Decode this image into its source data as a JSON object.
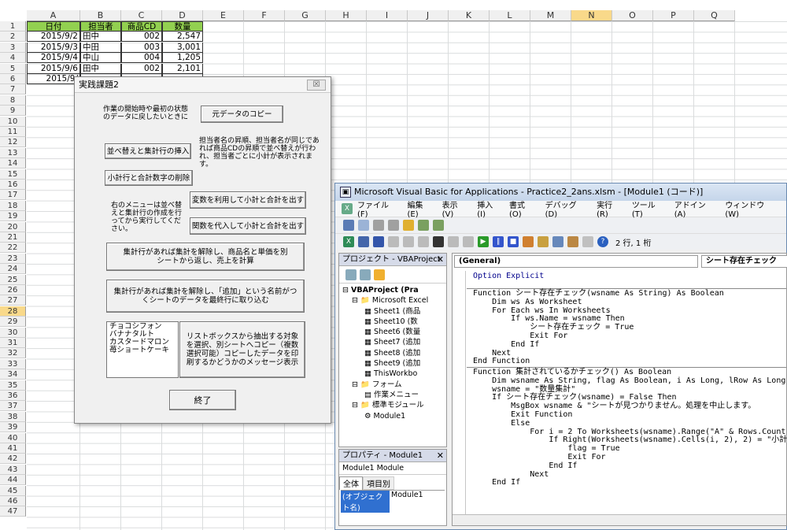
{
  "sheet": {
    "columns": [
      "A",
      "B",
      "C",
      "D",
      "E",
      "F",
      "G",
      "H",
      "I",
      "J",
      "K",
      "L",
      "M",
      "N",
      "O",
      "P",
      "Q"
    ],
    "rows": [
      "1",
      "2",
      "3",
      "4",
      "5",
      "6",
      "7",
      "8",
      "9",
      "10",
      "11",
      "12",
      "13",
      "14",
      "15",
      "16",
      "17",
      "18",
      "19",
      "20",
      "21",
      "22",
      "23",
      "24",
      "25",
      "26",
      "27",
      "28",
      "29",
      "30",
      "31",
      "32",
      "33",
      "34",
      "35",
      "36",
      "37",
      "38",
      "39",
      "40",
      "41",
      "42",
      "43",
      "44",
      "45",
      "46",
      "47"
    ],
    "header": [
      "日付",
      "担当者",
      "商品CD",
      "数量"
    ],
    "data": [
      [
        "2015/9/2",
        "田中",
        "002",
        "2,547"
      ],
      [
        "2015/9/3",
        "中田",
        "003",
        "3,001"
      ],
      [
        "2015/9/4",
        "中山",
        "004",
        "1,205"
      ],
      [
        "2015/9/6",
        "田中",
        "002",
        "2,101"
      ],
      [
        "2015/9/",
        "",
        "",
        ""
      ]
    ]
  },
  "form": {
    "title": "実践課題2",
    "close": "☒",
    "label1": "作業の開始時や最初の状態のデータに戻したいときに",
    "btn_copy": "元データのコピー",
    "btn_sort": "並べ替えと集計行の挿入",
    "label2": "担当者名の昇順、担当者名が同じであれば商品CDの昇順で並べ替えが行われ、担当者ごとに小計が表示されます。",
    "btn_delete": "小計行と合計数字の削除",
    "label3": "右のメニューは並べ替えと集計行の作成を行ってから実行してください。",
    "btn_var": "変数を利用して小計と合計を出す",
    "btn_func": "関数を代入して小計と合計を出す",
    "btn_clear1": "集計行があれば集計を解除し、商品名と単価を別シートから返し、売上を計算",
    "btn_clear2": "集計行があれば集計を解除し、「追加」という名前がつくシートのデータを最終行に取り込む",
    "list_items": [
      "チョコシフォン",
      "バナナタルト",
      "カスタードマロン",
      "苺ショートケーキ"
    ],
    "btn_list": "リストボックスから抽出する対象を選択、別シートへコピー（複数選択可能）コピーしたデータを印刷するかどうかのメッセージ表示",
    "btn_exit": "終了"
  },
  "vbe": {
    "title": "Microsoft Visual Basic for Applications - Practice2_2ans.xlsm - [Module1 (コード)]",
    "menus": [
      "ファイル(F)",
      "編集(E)",
      "表示(V)",
      "挿入(I)",
      "書式(O)",
      "デバッグ(D)",
      "実行(R)",
      "ツール(T)",
      "アドイン(A)",
      "ウィンドウ(W)"
    ],
    "position": "2 行, 1 桁",
    "project_title": "プロジェクト - VBAProject",
    "tree": [
      "VBAProject (Pra",
      "Microsoft Excel",
      "Sheet1 (商品",
      "Sheet10 (数",
      "Sheet6 (数量",
      "Sheet7 (追加",
      "Sheet8 (追加",
      "Sheet9 (追加",
      "ThisWorkbo",
      "フォーム",
      "作業メニュー",
      "標準モジュール",
      "Module1"
    ],
    "props_title": "プロパティ - Module1",
    "props_object": "Module1 Module",
    "props_tabs": [
      "全体",
      "項目別"
    ],
    "props_name_key": "(オブジェクト名)",
    "props_name_val": "Module1",
    "combo_left": "(General)",
    "combo_right": "シート存在チェック",
    "code1": "Option Explicit",
    "code2": "Function シート存在チェック(wsname As String) As Boolean\n    Dim ws As Worksheet\n    For Each ws In Worksheets\n        If ws.Name = wsname Then\n            シート存在チェック = True\n            Exit For\n        End If\n    Next\nEnd Function",
    "code3": "Function 集計されているかチェック() As Boolean\n    Dim wsname As String, flag As Boolean, i As Long, lRow As Long,\n    wsname = \"数量集計\"\n    If シート存在チェック(wsname) = False Then\n        MsgBox wsname & \"シートが見つかりません。処理を中止します。\n        Exit Function\n        Else\n            For i = 2 To Worksheets(wsname).Range(\"A\" & Rows.Count)\n                If Right(Worksheets(wsname).Cells(i, 2), 2) = \"小計\n                    flag = True\n                    Exit For\n                End If\n            Next\n    End If"
  }
}
